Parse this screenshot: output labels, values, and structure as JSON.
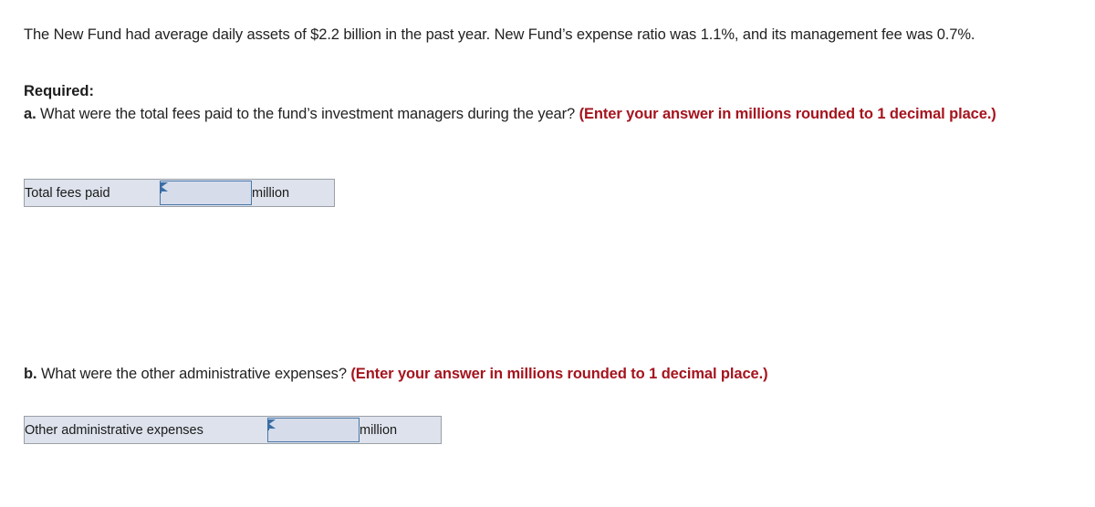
{
  "problem": {
    "statement": "The New Fund had average daily assets of $2.2 billion in the past year. New Fund’s expense ratio was 1.1%, and its management fee was 0.7%."
  },
  "required": {
    "heading": "Required:",
    "questions": [
      {
        "letter": "a.",
        "text": " What were the total fees paid to the fund’s investment managers during the year? ",
        "hint": "(Enter your answer in millions rounded to 1 decimal place.)"
      },
      {
        "letter": "b.",
        "text": " What were the other administrative expenses? ",
        "hint": "(Enter your answer in millions rounded to 1 decimal place.)"
      }
    ]
  },
  "answer_tables": [
    {
      "id": "fees",
      "label": "Total fees paid",
      "input_value": "",
      "input_placeholder": "",
      "unit": "million"
    },
    {
      "id": "admin",
      "label": "Other administrative expenses",
      "input_value": "",
      "input_placeholder": "",
      "unit": "million"
    }
  ],
  "colors": {
    "hint_red": "#a5141e",
    "table_fill": "#dde2ec",
    "table_border": "#9aa0a6",
    "input_border": "#4a78a8",
    "input_fill": "#d6dcea",
    "flag_blue": "#3a6ea5",
    "body_text": "#222222"
  }
}
